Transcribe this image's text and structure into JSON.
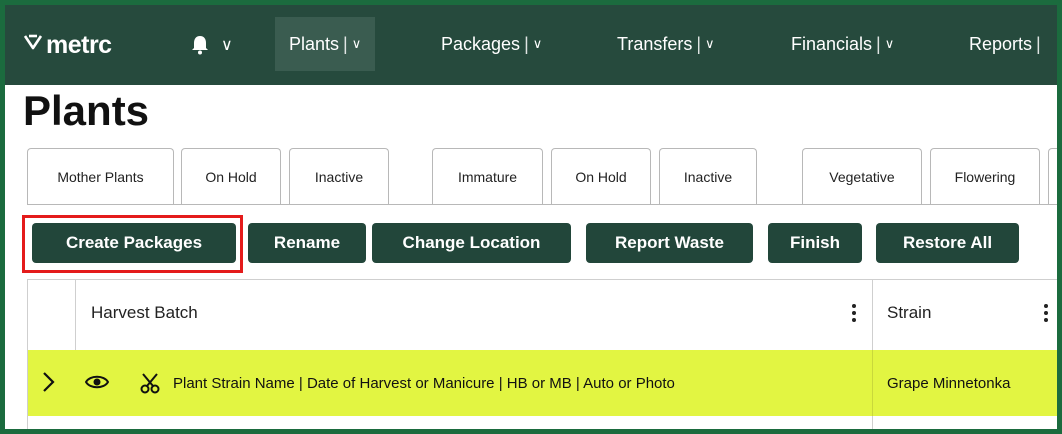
{
  "navbar": {
    "logo": "metrc",
    "logo_icon": "metrc-chevron-logo",
    "bell_icon": "bell-icon",
    "bell_chevron": "∨",
    "items": [
      {
        "label": "Plants",
        "sep": "|",
        "chevron": "∨"
      },
      {
        "label": "Packages",
        "sep": "|",
        "chevron": "∨"
      },
      {
        "label": "Transfers",
        "sep": "|",
        "chevron": "∨"
      },
      {
        "label": "Financials",
        "sep": "|",
        "chevron": "∨"
      },
      {
        "label": "Reports",
        "sep": "|",
        "chevron": ""
      }
    ],
    "active_item": "Plants",
    "colors": {
      "bar": "#264a3d",
      "active": "#3a5c50"
    }
  },
  "page": {
    "title": "Plants"
  },
  "tabs": [
    {
      "label": "Mother Plants"
    },
    {
      "label": "On Hold"
    },
    {
      "label": "Inactive"
    },
    {
      "label": "Immature"
    },
    {
      "label": "On Hold"
    },
    {
      "label": "Inactive"
    },
    {
      "label": "Vegetative"
    },
    {
      "label": "Flowering"
    }
  ],
  "actions": [
    {
      "label": "Create Packages",
      "highlighted": true
    },
    {
      "label": "Rename"
    },
    {
      "label": "Change Location"
    },
    {
      "label": "Report Waste"
    },
    {
      "label": "Finish"
    },
    {
      "label": "Restore All"
    }
  ],
  "grid": {
    "columns": [
      {
        "label": "Harvest Batch"
      },
      {
        "label": "Strain"
      }
    ],
    "rows": [
      {
        "expand_icon": "chevron-right-icon",
        "view_icon": "eye-icon",
        "action_icon": "scissors-icon",
        "harvest_batch": "Plant Strain Name | Date of Harvest or Manicure | HB or MB | Auto or Photo",
        "strain": "Grape Minnetonka",
        "highlight_color": "#e2f542"
      }
    ]
  },
  "colors": {
    "frame": "#1b6b3e",
    "button": "#22463a",
    "callout": "#e41b1b"
  }
}
